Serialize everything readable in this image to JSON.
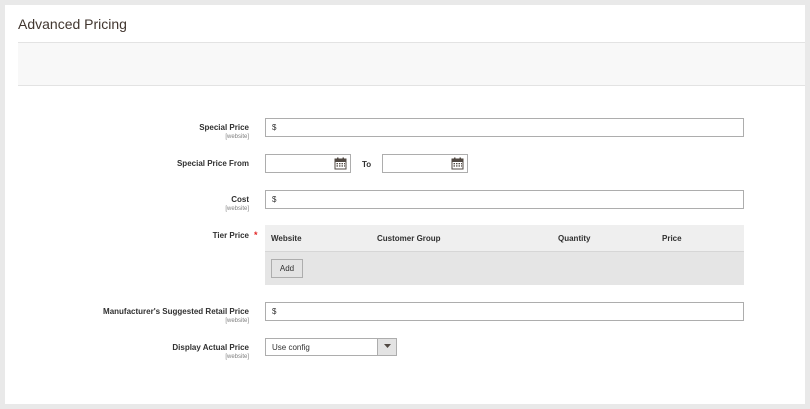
{
  "modal": {
    "title": "Advanced Pricing"
  },
  "fields": {
    "special_price": {
      "label": "Special Price",
      "scope": "[website]",
      "addon": "$",
      "value": ""
    },
    "special_price_from": {
      "label": "Special Price From",
      "to_label": "To",
      "from_value": "",
      "to_value": ""
    },
    "cost": {
      "label": "Cost",
      "scope": "[website]",
      "addon": "$",
      "value": ""
    },
    "tier_price": {
      "label": "Tier Price",
      "required_mark": "*",
      "columns": [
        "Website",
        "Customer Group",
        "Quantity",
        "Price"
      ],
      "add_label": "Add"
    },
    "msrp": {
      "label": "Manufacturer's Suggested Retail Price",
      "scope": "[website]",
      "addon": "$",
      "value": ""
    },
    "display_actual_price": {
      "label": "Display Actual Price",
      "scope": "[website]",
      "selected": "Use config"
    }
  },
  "icons": {
    "calendar": "calendar-icon",
    "dropdown": "chevron-down-icon"
  },
  "colors": {
    "required": "#e22626",
    "border": "#adadad",
    "panel": "#efefef"
  }
}
